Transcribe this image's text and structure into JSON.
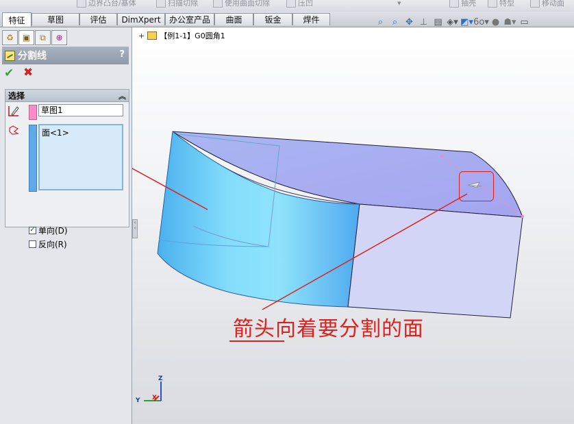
{
  "toolbar": {
    "items": [
      {
        "label": "边界凸台/基体",
        "icon": "boss-base-icon"
      },
      {
        "label": "扫描切除",
        "icon": "swept-cut-icon"
      },
      {
        "label": "使用曲面切除",
        "icon": "surface-cut-icon"
      },
      {
        "label": "压凹",
        "icon": "indent-icon"
      },
      {
        "label": "抽壳",
        "icon": "shell-icon"
      },
      {
        "label": "特型",
        "icon": "freeform-icon"
      },
      {
        "label": "移动面",
        "icon": "move-face-icon"
      }
    ]
  },
  "tabs": [
    {
      "label": "特征",
      "active": true
    },
    {
      "label": "草图"
    },
    {
      "label": "评估"
    },
    {
      "label": "DimXpert"
    },
    {
      "label": "办公室产品"
    },
    {
      "label": "曲面"
    },
    {
      "label": "钣金"
    },
    {
      "label": "焊件"
    }
  ],
  "tree": {
    "plus": "+",
    "label": "【例1-1】G0圆角1"
  },
  "property_manager": {
    "title": "分割线",
    "help": "?",
    "group_title": "选择",
    "sketch_value": "草图1",
    "face_items": [
      "面<1>"
    ],
    "options": [
      {
        "label": "单向(D)",
        "checked": true
      },
      {
        "label": "反向(R)",
        "checked": false
      }
    ],
    "ok_glyph": "✔",
    "cancel_glyph": "✖"
  },
  "annotation": {
    "caption": "箭头向着要分割的面"
  },
  "triad": {
    "z": "Z",
    "y": "Y",
    "x": "X"
  },
  "colors": {
    "annotation_red": "#e0201c",
    "face_blue": "#6fc3f5",
    "top_face": "#a9a8f0",
    "side_face": "#d4d6f7"
  }
}
